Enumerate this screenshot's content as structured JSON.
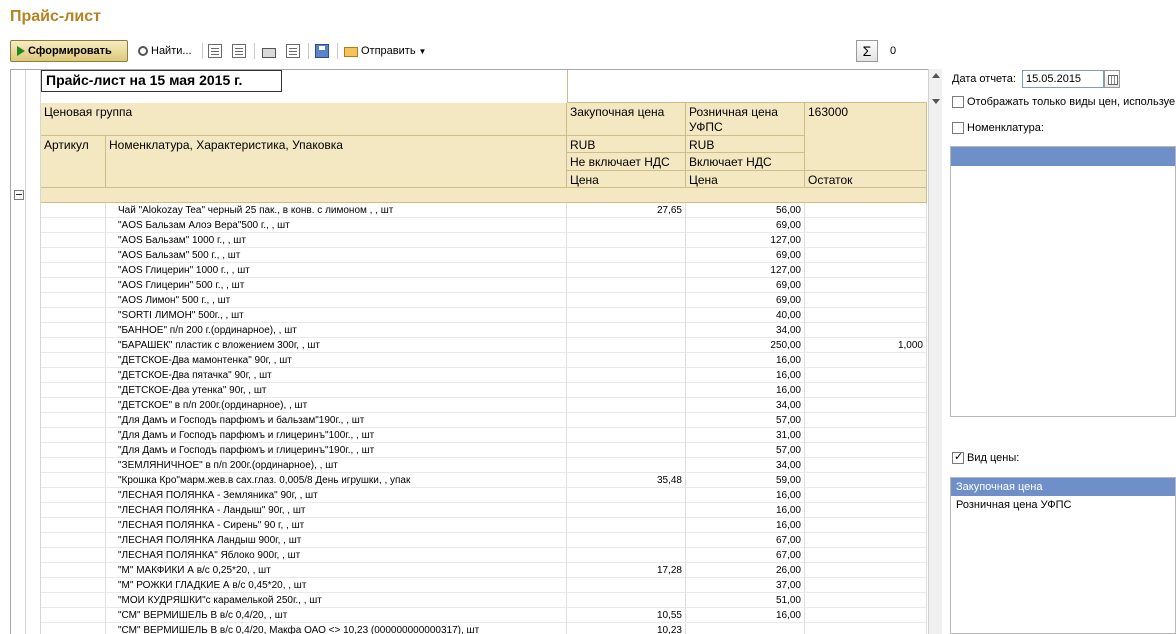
{
  "window": {
    "title": "Прайс-лист"
  },
  "toolbar": {
    "generate": "Сформировать",
    "find": "Найти...",
    "send": "Отправить",
    "sum_value": "0"
  },
  "report": {
    "title": "Прайс-лист на 15 мая 2015 г.",
    "h_price_group": "Ценовая группа",
    "h_purchase": "Закупочная цена",
    "h_retail": "Розничная цена УФПС",
    "h_stock_code": "163000",
    "h_article": "Артикул",
    "h_nomenclature": "Номенклатура, Характеристика, Упаковка",
    "h_currency1": "RUB",
    "h_currency2": "RUB",
    "h_vat1": "Не включает НДС",
    "h_vat2": "Включает НДС",
    "h_price1": "Цена",
    "h_price2": "Цена",
    "h_stock": "Остаток"
  },
  "rows": [
    {
      "name": "Чай \"Alokozay Tea\" черный 25 пак., в конв. с лимоном , , шт",
      "purchase": "27,65",
      "retail": "56,00",
      "stock": ""
    },
    {
      "name": "\"AOS Бальзам Алоэ Вера\"500 г., , шт",
      "purchase": "",
      "retail": "69,00",
      "stock": ""
    },
    {
      "name": "\"AOS Бальзам\" 1000 г., , шт",
      "purchase": "",
      "retail": "127,00",
      "stock": ""
    },
    {
      "name": "\"AOS Бальзам\" 500 г., , шт",
      "purchase": "",
      "retail": "69,00",
      "stock": ""
    },
    {
      "name": "\"AOS Глицерин\" 1000 г., , шт",
      "purchase": "",
      "retail": "127,00",
      "stock": ""
    },
    {
      "name": "\"AOS Глицерин\" 500 г., , шт",
      "purchase": "",
      "retail": "69,00",
      "stock": ""
    },
    {
      "name": "\"AOS Лимон\" 500 г., , шт",
      "purchase": "",
      "retail": "69,00",
      "stock": ""
    },
    {
      "name": "\"SORTI ЛИМОН\" 500г., , шт",
      "purchase": "",
      "retail": "40,00",
      "stock": ""
    },
    {
      "name": "\"БАННОЕ\" п/п 200 г.(ординарное), , шт",
      "purchase": "",
      "retail": "34,00",
      "stock": ""
    },
    {
      "name": "\"БАРАШЕК\" пластик с вложением 300г, , шт",
      "purchase": "",
      "retail": "250,00",
      "stock": "1,000"
    },
    {
      "name": "\"ДЕТСКОЕ-Два мамонтенка\" 90г, , шт",
      "purchase": "",
      "retail": "16,00",
      "stock": ""
    },
    {
      "name": "\"ДЕТСКОЕ-Два пятачка\" 90г, , шт",
      "purchase": "",
      "retail": "16,00",
      "stock": ""
    },
    {
      "name": "\"ДЕТСКОЕ-Два утенка\" 90г, , шт",
      "purchase": "",
      "retail": "16,00",
      "stock": ""
    },
    {
      "name": "\"ДЕТСКОЕ\" в п/п 200г.(ординарное), , шт",
      "purchase": "",
      "retail": "34,00",
      "stock": ""
    },
    {
      "name": "\"Для Дамъ и Господъ парфюмъ и бальзам\"190г., , шт",
      "purchase": "",
      "retail": "57,00",
      "stock": ""
    },
    {
      "name": "\"Для Дамъ и Господъ парфюмъ и глицеринъ\"100г., , шт",
      "purchase": "",
      "retail": "31,00",
      "stock": ""
    },
    {
      "name": "\"Для Дамъ и Господъ парфюмъ и глицеринъ\"190г., , шт",
      "purchase": "",
      "retail": "57,00",
      "stock": ""
    },
    {
      "name": "\"ЗЕМЛЯНИЧНОЕ\" в п/п 200г.(ординарное), , шт",
      "purchase": "",
      "retail": "34,00",
      "stock": ""
    },
    {
      "name": "\"Крошка Кро\"марм.жев.в сах.глаз. 0,005/8 День игрушки, , упак",
      "purchase": "35,48",
      "retail": "59,00",
      "stock": ""
    },
    {
      "name": "\"ЛЕСНАЯ ПОЛЯНКА - Земляника\" 90г, , шт",
      "purchase": "",
      "retail": "16,00",
      "stock": ""
    },
    {
      "name": "\"ЛЕСНАЯ ПОЛЯНКА - Ландыш\" 90г, , шт",
      "purchase": "",
      "retail": "16,00",
      "stock": ""
    },
    {
      "name": "\"ЛЕСНАЯ ПОЛЯНКА - Сирень\" 90 г, , шт",
      "purchase": "",
      "retail": "16,00",
      "stock": ""
    },
    {
      "name": "\"ЛЕСНАЯ ПОЛЯНКА Ландыш 900г, , шт",
      "purchase": "",
      "retail": "67,00",
      "stock": ""
    },
    {
      "name": "\"ЛЕСНАЯ ПОЛЯНКА\" Яблоко 900г, , шт",
      "purchase": "",
      "retail": "67,00",
      "stock": ""
    },
    {
      "name": "\"М\" МАКФИКИ А в/с 0,25*20, , шт",
      "purchase": "17,28",
      "retail": "26,00",
      "stock": ""
    },
    {
      "name": "\"М\" РОЖКИ ГЛАДКИЕ А в/с 0,45*20, , шт",
      "purchase": "",
      "retail": "37,00",
      "stock": ""
    },
    {
      "name": "\"МОИ КУДРЯШКИ\"с карамелькой 250г., , шт",
      "purchase": "",
      "retail": "51,00",
      "stock": ""
    },
    {
      "name": "\"СМ\" ВЕРМИШЕЛЬ В в/с 0,4/20, , шт",
      "purchase": "10,55",
      "retail": "16,00",
      "stock": ""
    },
    {
      "name": "\"СМ\" ВЕРМИШЕЛЬ В в/с 0,4/20, Макфа ОАО <> 10,23 (000000000000317), шт",
      "purchase": "10,23",
      "retail": "",
      "stock": ""
    }
  ],
  "panel": {
    "date_label": "Дата отчета:",
    "date_value": "15.05.2015",
    "only_types_label": "Отображать только виды цен, используе",
    "nomenclature_label": "Номенклатура:",
    "price_type_label": "Вид цены:",
    "price_types": [
      "Закупочная цена",
      "Розничная цена УФПС"
    ]
  }
}
